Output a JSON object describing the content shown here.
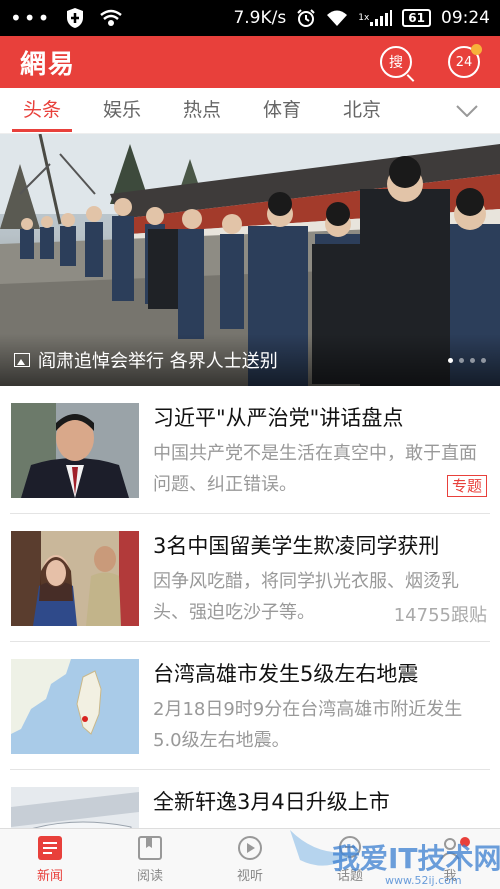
{
  "status_bar": {
    "net_speed": "7.9K/s",
    "signal_label": "1x",
    "battery": "61",
    "time": "09:24"
  },
  "header": {
    "logo": "網易",
    "search_label": "搜",
    "badge_count": "24",
    "accent_color": "#e8403b"
  },
  "tabs": [
    {
      "label": "头条",
      "active": true
    },
    {
      "label": "娱乐",
      "active": false
    },
    {
      "label": "热点",
      "active": false
    },
    {
      "label": "体育",
      "active": false
    },
    {
      "label": "北京",
      "active": false
    }
  ],
  "hero": {
    "caption": "阎肃追悼会举行 各界人士送别",
    "page_count": 4,
    "current_page": 1
  },
  "news": [
    {
      "title": "习近平\"从严治党\"讲话盘点",
      "summary": "中国共产党不是生活在真空中，敢于直面问题、纠正错误。",
      "tag": "专题",
      "thumb_icon": "portrait-photo"
    },
    {
      "title": "3名中国留美学生欺凌同学获刑",
      "summary": "因争风吃醋，将同学扒光衣服、烟烫乳头、强迫吃沙子等。",
      "count": "14755跟贴",
      "thumb_icon": "courtroom-photo"
    },
    {
      "title": "台湾高雄市发生5级左右地震",
      "summary": "2月18日9时9分在台湾高雄市附近发生5.0级左右地震。",
      "thumb_icon": "map-image"
    },
    {
      "title": "全新轩逸3月4日升级上市",
      "summary": "",
      "thumb_icon": "car-photo"
    }
  ],
  "bottom_nav": [
    {
      "label": "新闻",
      "icon": "news-icon",
      "active": true
    },
    {
      "label": "阅读",
      "icon": "reading-icon",
      "active": false
    },
    {
      "label": "视听",
      "icon": "play-icon",
      "active": false
    },
    {
      "label": "话题",
      "icon": "topic-icon",
      "active": false
    },
    {
      "label": "我",
      "icon": "profile-icon",
      "active": false
    }
  ],
  "watermark": {
    "text": "我爱IT技术网",
    "url": "www.52ij.com"
  }
}
